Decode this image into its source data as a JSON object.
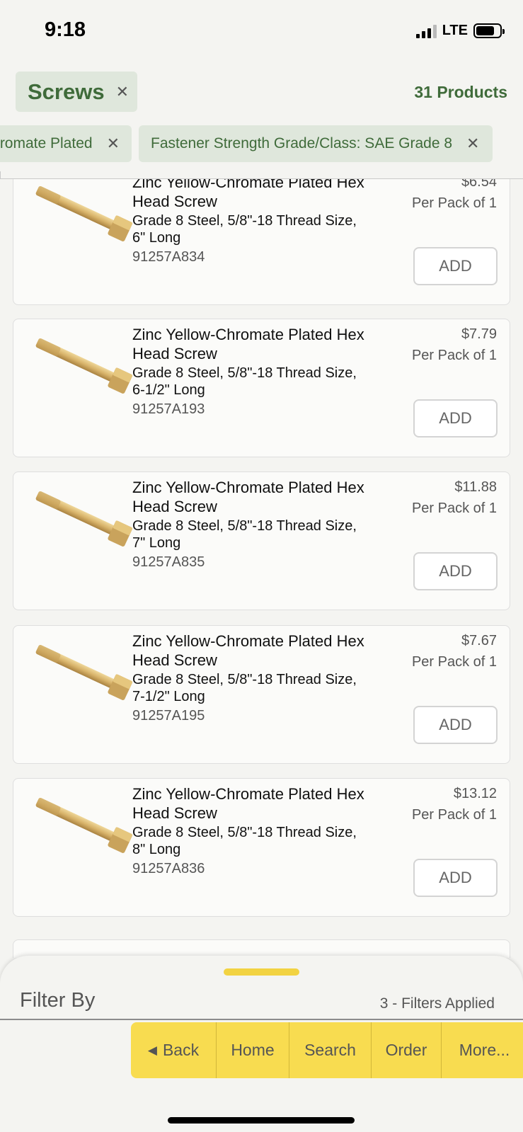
{
  "status_bar": {
    "time": "9:18",
    "network": "LTE"
  },
  "header": {
    "category": "Screws",
    "product_count": "31 Products",
    "filters": [
      {
        "label": "romate Plated"
      },
      {
        "label": "Fastener Strength Grade/Class: SAE Grade 8"
      }
    ]
  },
  "products": [
    {
      "name": "Zinc Yellow-Chromate Plated Hex Head Screw",
      "spec": "Grade 8 Steel, 5/8\"-18 Thread Size, 6\" Long",
      "part_number": "91257A834",
      "price": "$6.54",
      "pack": "Per Pack of 1",
      "add_label": "ADD"
    },
    {
      "name": "Zinc Yellow-Chromate Plated Hex Head Screw",
      "spec": "Grade 8 Steel, 5/8\"-18 Thread Size, 6-1/2\" Long",
      "part_number": "91257A193",
      "price": "$7.79",
      "pack": "Per Pack of 1",
      "add_label": "ADD"
    },
    {
      "name": "Zinc Yellow-Chromate Plated Hex Head Screw",
      "spec": "Grade 8 Steel, 5/8\"-18 Thread Size, 7\" Long",
      "part_number": "91257A835",
      "price": "$11.88",
      "pack": "Per Pack of 1",
      "add_label": "ADD"
    },
    {
      "name": "Zinc Yellow-Chromate Plated Hex Head Screw",
      "spec": "Grade 8 Steel, 5/8\"-18 Thread Size, 7-1/2\" Long",
      "part_number": "91257A195",
      "price": "$7.67",
      "pack": "Per Pack of 1",
      "add_label": "ADD"
    },
    {
      "name": "Zinc Yellow-Chromate Plated Hex Head Screw",
      "spec": "Grade 8 Steel, 5/8\"-18 Thread Size, 8\" Long",
      "part_number": "91257A836",
      "price": "$13.12",
      "pack": "Per Pack of 1",
      "add_label": "ADD"
    }
  ],
  "bottom_sheet": {
    "filter_by": "Filter By",
    "filters_applied": "3 - Filters Applied"
  },
  "nav": {
    "back": "Back",
    "home": "Home",
    "search": "Search",
    "order": "Order",
    "more": "More..."
  },
  "colors": {
    "accent_green": "#3f6b3a",
    "chip_bg": "#dfe7dc",
    "nav_yellow": "#f8dc50",
    "handle_yellow": "#f2d342"
  }
}
